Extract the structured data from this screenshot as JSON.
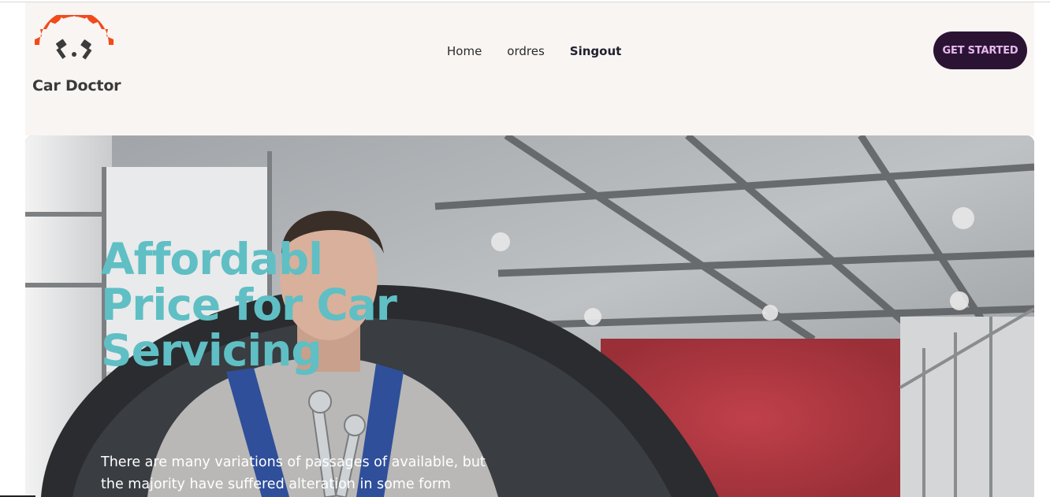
{
  "brand": {
    "name": "Car Doctor",
    "accent": "#f24b1b"
  },
  "nav": {
    "links": [
      "Home",
      "ordres",
      "Singout"
    ]
  },
  "cta": {
    "label": "GET STARTED",
    "color": "#2b1433"
  },
  "hero": {
    "title": "Affordabl Price for Car Servicing",
    "title_color": "#5fbfc4",
    "description": "There are many variations of passages of available, but the majority have suffered alteration in some form"
  },
  "icons": {
    "logo": "gear-piston-logo-icon"
  }
}
